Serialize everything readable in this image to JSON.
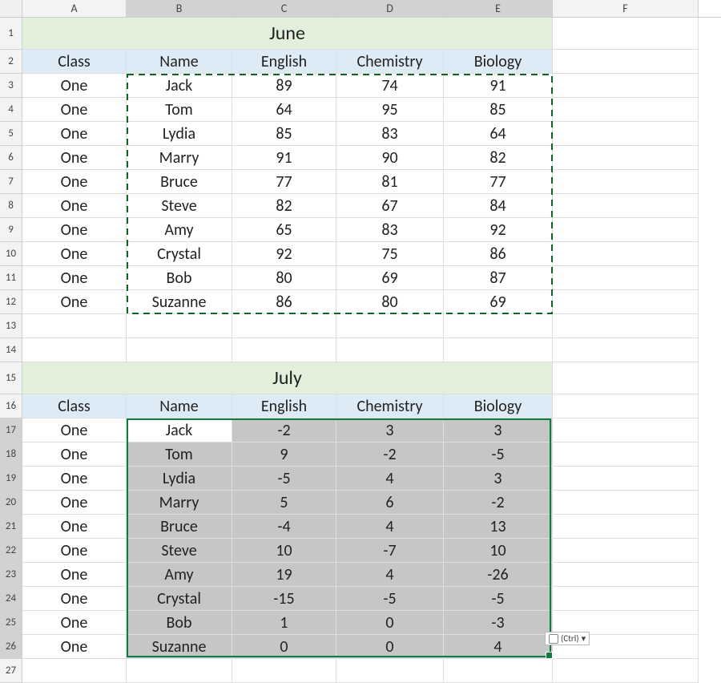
{
  "columns": [
    "A",
    "B",
    "C",
    "D",
    "E",
    "F"
  ],
  "june": {
    "title": "June",
    "headers": [
      "Class",
      "Name",
      "English",
      "Chemistry",
      "Biology"
    ],
    "rows": [
      {
        "class": "One",
        "name": "Jack",
        "english": "89",
        "chemistry": "74",
        "biology": "91"
      },
      {
        "class": "One",
        "name": "Tom",
        "english": "64",
        "chemistry": "95",
        "biology": "85"
      },
      {
        "class": "One",
        "name": "Lydia",
        "english": "85",
        "chemistry": "83",
        "biology": "64"
      },
      {
        "class": "One",
        "name": "Marry",
        "english": "91",
        "chemistry": "90",
        "biology": "82"
      },
      {
        "class": "One",
        "name": "Bruce",
        "english": "77",
        "chemistry": "81",
        "biology": "77"
      },
      {
        "class": "One",
        "name": "Steve",
        "english": "82",
        "chemistry": "67",
        "biology": "84"
      },
      {
        "class": "One",
        "name": "Amy",
        "english": "65",
        "chemistry": "83",
        "biology": "92"
      },
      {
        "class": "One",
        "name": "Crystal",
        "english": "92",
        "chemistry": "75",
        "biology": "86"
      },
      {
        "class": "One",
        "name": "Bob",
        "english": "80",
        "chemistry": "69",
        "biology": "87"
      },
      {
        "class": "One",
        "name": "Suzanne",
        "english": "86",
        "chemistry": "80",
        "biology": "69"
      }
    ]
  },
  "july": {
    "title": "July",
    "headers": [
      "Class",
      "Name",
      "English",
      "Chemistry",
      "Biology"
    ],
    "rows": [
      {
        "class": "One",
        "name": "Jack",
        "english": "-2",
        "chemistry": "3",
        "biology": "3"
      },
      {
        "class": "One",
        "name": "Tom",
        "english": "9",
        "chemistry": "-2",
        "biology": "-5"
      },
      {
        "class": "One",
        "name": "Lydia",
        "english": "-5",
        "chemistry": "4",
        "biology": "3"
      },
      {
        "class": "One",
        "name": "Marry",
        "english": "5",
        "chemistry": "6",
        "biology": "-2"
      },
      {
        "class": "One",
        "name": "Bruce",
        "english": "-4",
        "chemistry": "4",
        "biology": "13"
      },
      {
        "class": "One",
        "name": "Steve",
        "english": "10",
        "chemistry": "-7",
        "biology": "10"
      },
      {
        "class": "One",
        "name": "Amy",
        "english": "19",
        "chemistry": "4",
        "biology": "-26"
      },
      {
        "class": "One",
        "name": "Crystal",
        "english": "-15",
        "chemistry": "-5",
        "biology": "-5"
      },
      {
        "class": "One",
        "name": "Bob",
        "english": "1",
        "chemistry": "0",
        "biology": "-3"
      },
      {
        "class": "One",
        "name": "Suzanne",
        "english": "0",
        "chemistry": "0",
        "biology": "4"
      }
    ]
  },
  "paste_hint": "(Ctrl)"
}
